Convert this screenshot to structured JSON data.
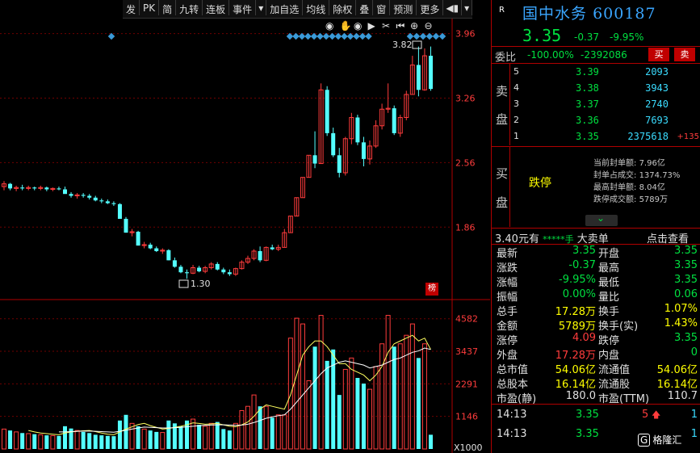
{
  "toolbar": {
    "items": [
      "发",
      "PK",
      "简",
      "九转",
      "连板",
      "事件",
      "▾",
      "加自选",
      "均线",
      "除权",
      "叠",
      "窗",
      "预测",
      "更多",
      "◀▮",
      "▾"
    ]
  },
  "chart": {
    "price_ticks": [
      "3.96",
      "3.26",
      "2.56",
      "1.86"
    ],
    "vol_ticks": [
      "4582",
      "3437",
      "2291",
      "1146"
    ],
    "vol_unit": "X1000",
    "high_label": "3.82",
    "low_label": "1.30",
    "badge": "榜"
  },
  "chart_data": {
    "type": "candlestick",
    "price_range": [
      1.1,
      4.15
    ],
    "volume_range": [
      0,
      5000
    ],
    "candles": [
      [
        2.3,
        2.36,
        2.26,
        2.33
      ],
      [
        2.33,
        2.34,
        2.26,
        2.28
      ],
      [
        2.28,
        2.31,
        2.25,
        2.29
      ],
      [
        2.29,
        2.32,
        2.26,
        2.28
      ],
      [
        2.28,
        2.31,
        2.26,
        2.29
      ],
      [
        2.29,
        2.3,
        2.26,
        2.28
      ],
      [
        2.28,
        2.31,
        2.26,
        2.29
      ],
      [
        2.29,
        2.3,
        2.25,
        2.27
      ],
      [
        2.27,
        2.29,
        2.25,
        2.28
      ],
      [
        2.28,
        2.3,
        2.26,
        2.27
      ],
      [
        2.27,
        2.3,
        2.23,
        2.22
      ],
      [
        2.22,
        2.24,
        2.18,
        2.2
      ],
      [
        2.2,
        2.23,
        2.17,
        2.21
      ],
      [
        2.21,
        2.23,
        2.18,
        2.2
      ],
      [
        2.2,
        2.22,
        2.16,
        2.18
      ],
      [
        2.18,
        2.2,
        2.14,
        2.15
      ],
      [
        2.15,
        2.17,
        2.12,
        2.14
      ],
      [
        2.14,
        2.16,
        2.11,
        2.12
      ],
      [
        2.12,
        2.14,
        2.09,
        2.11
      ],
      [
        2.11,
        2.12,
        1.96,
        1.95
      ],
      [
        1.95,
        1.97,
        1.8,
        1.8
      ],
      [
        1.8,
        1.84,
        1.76,
        1.81
      ],
      [
        1.81,
        1.82,
        1.66,
        1.66
      ],
      [
        1.66,
        1.7,
        1.63,
        1.67
      ],
      [
        1.67,
        1.69,
        1.62,
        1.63
      ],
      [
        1.63,
        1.65,
        1.59,
        1.6
      ],
      [
        1.6,
        1.63,
        1.57,
        1.61
      ],
      [
        1.61,
        1.62,
        1.5,
        1.5
      ],
      [
        1.5,
        1.53,
        1.42,
        1.43
      ],
      [
        1.43,
        1.45,
        1.36,
        1.37
      ],
      [
        1.37,
        1.4,
        1.3,
        1.36
      ],
      [
        1.36,
        1.45,
        1.35,
        1.42
      ],
      [
        1.42,
        1.44,
        1.37,
        1.38
      ],
      [
        1.38,
        1.44,
        1.36,
        1.42
      ],
      [
        1.42,
        1.48,
        1.4,
        1.46
      ],
      [
        1.46,
        1.48,
        1.39,
        1.4
      ],
      [
        1.4,
        1.42,
        1.35,
        1.37
      ],
      [
        1.37,
        1.4,
        1.33,
        1.35
      ],
      [
        1.35,
        1.42,
        1.33,
        1.41
      ],
      [
        1.41,
        1.5,
        1.4,
        1.48
      ],
      [
        1.48,
        1.55,
        1.46,
        1.52
      ],
      [
        1.52,
        1.62,
        1.5,
        1.6
      ],
      [
        1.6,
        1.65,
        1.48,
        1.5
      ],
      [
        1.5,
        1.65,
        1.49,
        1.64
      ],
      [
        1.64,
        1.67,
        1.61,
        1.62
      ],
      [
        1.62,
        1.67,
        1.6,
        1.64
      ],
      [
        1.64,
        1.84,
        1.64,
        1.8
      ],
      [
        1.8,
        1.98,
        1.8,
        1.98
      ],
      [
        1.98,
        2.18,
        1.98,
        2.18
      ],
      [
        2.18,
        2.4,
        2.18,
        2.4
      ],
      [
        2.4,
        2.64,
        2.4,
        2.64
      ],
      [
        2.64,
        2.9,
        2.5,
        2.55
      ],
      [
        2.55,
        3.42,
        2.55,
        3.35
      ],
      [
        3.35,
        3.39,
        2.85,
        2.88
      ],
      [
        2.88,
        2.94,
        2.62,
        2.64
      ],
      [
        2.64,
        2.72,
        2.4,
        2.45
      ],
      [
        2.45,
        2.84,
        2.42,
        2.82
      ],
      [
        2.82,
        3.1,
        2.76,
        3.05
      ],
      [
        3.05,
        3.08,
        2.75,
        2.78
      ],
      [
        2.78,
        2.84,
        2.52,
        2.6
      ],
      [
        2.6,
        2.8,
        2.54,
        2.74
      ],
      [
        2.74,
        3.02,
        2.72,
        2.96
      ],
      [
        2.96,
        3.2,
        2.92,
        3.14
      ],
      [
        3.14,
        3.42,
        3.1,
        3.15
      ],
      [
        3.15,
        3.18,
        2.86,
        2.88
      ],
      [
        2.88,
        3.08,
        2.84,
        3.05
      ],
      [
        3.05,
        3.34,
        3.02,
        3.3
      ],
      [
        3.3,
        3.72,
        3.3,
        3.62
      ],
      [
        3.62,
        3.82,
        3.28,
        3.35
      ],
      [
        3.35,
        3.8,
        3.34,
        3.72
      ],
      [
        3.72,
        3.82,
        3.34,
        3.36
      ]
    ],
    "volumes": [
      700,
      650,
      600,
      560,
      540,
      520,
      500,
      480,
      470,
      460,
      800,
      720,
      650,
      600,
      560,
      500,
      480,
      460,
      450,
      1000,
      1200,
      900,
      800,
      700,
      650,
      600,
      580,
      1000,
      900,
      800,
      1000,
      1050,
      850,
      800,
      900,
      950,
      700,
      650,
      900,
      1350,
      1500,
      1900,
      1500,
      1500,
      1100,
      1200,
      1200,
      3900,
      4600,
      4400,
      2400,
      3600,
      4700,
      3100,
      3500,
      1900,
      2800,
      3200,
      2500,
      2300,
      2100,
      2900,
      3700,
      4700,
      3600,
      3700,
      4000,
      4400,
      3200,
      3700,
      500
    ],
    "ma_fast": [
      null,
      null,
      null,
      null,
      650,
      600,
      560,
      540,
      520,
      500,
      560,
      600,
      620,
      640,
      650,
      610,
      560,
      520,
      500,
      600,
      700,
      780,
      860,
      900,
      820,
      760,
      700,
      720,
      760,
      800,
      850,
      920,
      900,
      870,
      880,
      900,
      850,
      800,
      780,
      850,
      950,
      1150,
      1400,
      1550,
      1500,
      1450,
      1400,
      1900,
      2600,
      3300,
      3600,
      3800,
      3800,
      3600,
      3300,
      3000,
      3000,
      2800,
      2700,
      2600,
      2400,
      2600,
      2900,
      3400,
      3700,
      3800,
      3900,
      4000,
      3800,
      3900,
      3500
    ],
    "ma_slow": [
      null,
      null,
      null,
      null,
      null,
      null,
      null,
      null,
      null,
      600,
      600,
      610,
      620,
      630,
      630,
      620,
      610,
      600,
      590,
      620,
      660,
      700,
      740,
      770,
      760,
      750,
      740,
      740,
      750,
      760,
      780,
      800,
      820,
      830,
      840,
      850,
      850,
      840,
      830,
      840,
      870,
      930,
      1000,
      1080,
      1130,
      1170,
      1200,
      1400,
      1650,
      1900,
      2150,
      2400,
      2650,
      2850,
      2950,
      3050,
      3100,
      3050,
      3000,
      2950,
      2850,
      2900,
      2950,
      3050,
      3150,
      3200,
      3300,
      3400,
      3450,
      3550,
      3500
    ]
  },
  "quote": {
    "flag": "R",
    "name": "国中水务",
    "code": "600187",
    "price": "3.35",
    "change": "-0.37",
    "change_pct": "-9.95%",
    "weibi_label": "委比",
    "weibi_value": "-100.00%",
    "weicha_value": "-2392086",
    "buy_btn": "买",
    "sell_btn": "卖",
    "sell_side_label1": "卖",
    "sell_side_label2": "盘",
    "buy_side_label1": "买",
    "buy_side_label2": "盘",
    "asks": [
      {
        "level": "5",
        "price": "3.39",
        "vol": "2093"
      },
      {
        "level": "4",
        "price": "3.38",
        "vol": "3943"
      },
      {
        "level": "3",
        "price": "3.37",
        "vol": "2740"
      },
      {
        "level": "2",
        "price": "3.36",
        "vol": "7693"
      },
      {
        "level": "1",
        "price": "3.35",
        "vol": "2375618",
        "delta": "+135"
      }
    ],
    "limit_down_label": "跌停",
    "seal_info": [
      {
        "k": "当前封单额:",
        "v": "7.96亿"
      },
      {
        "k": "封单占成交:",
        "v": "1374.73%"
      },
      {
        "k": "最高封单额:",
        "v": "8.04亿"
      },
      {
        "k": "跌停成交额:",
        "v": "5789万"
      }
    ],
    "big_order": {
      "price": "3.40元有",
      "stars": "*****手",
      "text": "大卖单",
      "link": "点击查看"
    }
  },
  "stats": {
    "left": [
      {
        "k": "最新",
        "v": "3.35",
        "c": "g"
      },
      {
        "k": "涨跌",
        "v": "-0.37",
        "c": "g"
      },
      {
        "k": "涨幅",
        "v": "-9.95%",
        "c": "g"
      },
      {
        "k": "振幅",
        "v": "0.00%",
        "c": "g"
      },
      {
        "k": "总手",
        "v": "17.28万",
        "c": "y"
      },
      {
        "k": "金额",
        "v": "5789万",
        "c": "y"
      },
      {
        "k": "涨停",
        "v": "4.09",
        "c": "r"
      },
      {
        "k": "外盘",
        "v": "17.28万",
        "c": "r"
      },
      {
        "k": "总市值",
        "v": "54.06亿",
        "c": "y"
      },
      {
        "k": "总股本",
        "v": "16.14亿",
        "c": "y"
      },
      {
        "k": "市盈(静)",
        "v": "180.0",
        "c": "w"
      }
    ],
    "right": [
      {
        "k": "开盘",
        "v": "3.35",
        "c": "g"
      },
      {
        "k": "最高",
        "v": "3.35",
        "c": "g"
      },
      {
        "k": "最低",
        "v": "3.35",
        "c": "g"
      },
      {
        "k": "量比",
        "v": "0.06",
        "c": "g"
      },
      {
        "k": "换手",
        "v": "1.07%",
        "c": "y"
      },
      {
        "k": "换手(实)",
        "v": "1.43%",
        "c": "y"
      },
      {
        "k": "跌停",
        "v": "3.35",
        "c": "g"
      },
      {
        "k": "内盘",
        "v": "0",
        "c": "g"
      },
      {
        "k": "流通值",
        "v": "54.06亿",
        "c": "y"
      },
      {
        "k": "流通股",
        "v": "16.14亿",
        "c": "y"
      },
      {
        "k": "市盈(TTM)",
        "v": "110.7",
        "c": "w"
      }
    ]
  },
  "ticks": [
    {
      "t": "14:13",
      "p": "3.35",
      "v": "5",
      "n": "1"
    },
    {
      "t": "14:13",
      "p": "3.35",
      "v": "",
      "n": "1"
    }
  ],
  "watermark": "格隆汇"
}
